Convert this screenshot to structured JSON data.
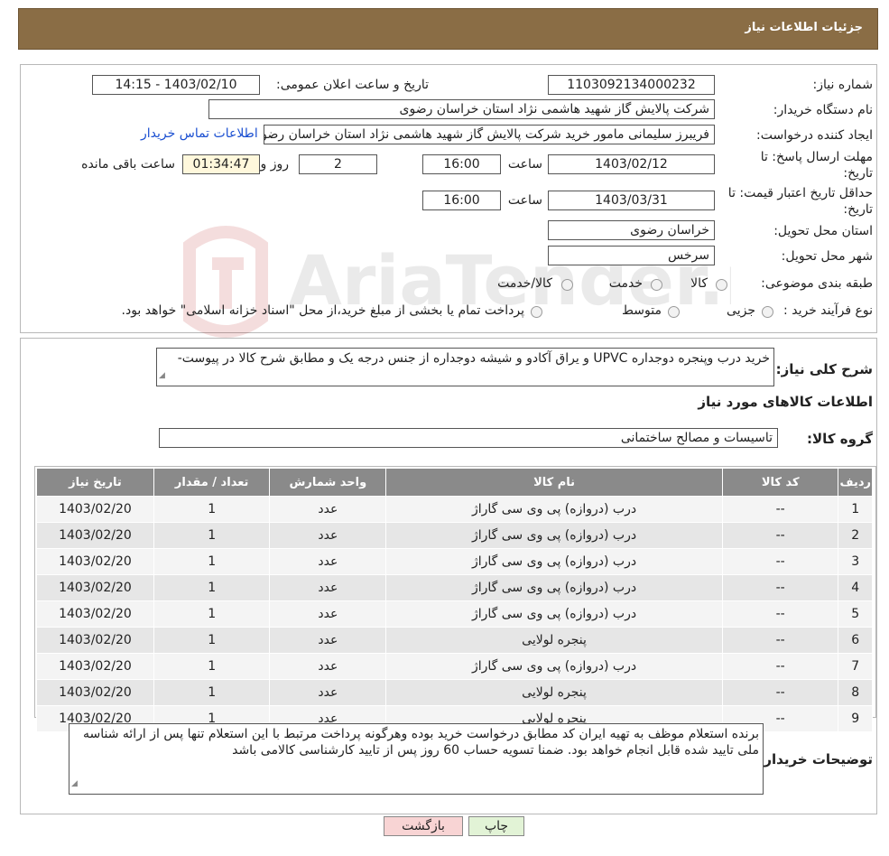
{
  "header": {
    "title": "جزئیات اطلاعات نیاز"
  },
  "form": {
    "need_number_label": "شماره نیاز:",
    "need_number": "1103092134000232",
    "announce_label": "تاریخ و ساعت اعلان عمومی:",
    "announce_value": "1403/02/10 - 14:15",
    "buyer_org_label": "نام دستگاه خریدار:",
    "buyer_org": "شرکت پالایش گاز شهید هاشمی نژاد   استان خراسان رضوی",
    "creator_label": "ایجاد کننده درخواست:",
    "creator": "فریبرز  سلیمانی مامور خرید شرکت پالایش گاز شهید هاشمی نژاد   استان خراسان رضوی",
    "contact_link": "اطلاعات تماس خریدار",
    "deadline_label_1": "مهلت ارسال پاسخ: تا",
    "deadline_label_2": "تاریخ:",
    "deadline_date": "1403/02/12",
    "time_label": "ساعت",
    "deadline_time": "16:00",
    "days_value": "2",
    "days_label": "روز و",
    "remaining_value": "01:34:47",
    "remaining_label": "ساعت باقی مانده",
    "validity_label_1": "حداقل تاریخ اعتبار قیمت: تا",
    "validity_label_2": "تاریخ:",
    "validity_date": "1403/03/31",
    "validity_time": "16:00",
    "province_label": "استان محل تحویل:",
    "province": "خراسان رضوی",
    "city_label": "شهر محل تحویل:",
    "city": "سرخس",
    "category_label": "طبقه بندی موضوعی:",
    "category_options": [
      "کالا",
      "خدمت",
      "کالا/خدمت"
    ],
    "process_label": "نوع فرآیند خرید :",
    "process_options": [
      "جزیی",
      "متوسط"
    ],
    "process_note": "پرداخت تمام یا بخشی از مبلغ خرید،از محل \"اسناد خزانه اسلامی\" خواهد بود."
  },
  "details": {
    "summary_label": "شرح کلی نیاز:",
    "summary": "خرید درب وپنجره دوجداره  UPVC  و یراق آکادو و شیشه دوجداره از جنس درجه یک و مطابق شرح کالا در پیوست-",
    "goods_info_title": "اطلاعات کالاهای مورد نیاز",
    "goods_group_label": "گروه کالا:",
    "goods_group": "تاسیسات و مصالح ساختمانی"
  },
  "table": {
    "headers": [
      "ردیف",
      "کد کالا",
      "نام کالا",
      "واحد شمارش",
      "تعداد / مقدار",
      "تاریخ نیاز"
    ],
    "rows": [
      [
        "1",
        "--",
        "درب (دروازه) پی وی سی گاراژ",
        "عدد",
        "1",
        "1403/02/20"
      ],
      [
        "2",
        "--",
        "درب (دروازه) پی وی سی گاراژ",
        "عدد",
        "1",
        "1403/02/20"
      ],
      [
        "3",
        "--",
        "درب (دروازه) پی وی سی گاراژ",
        "عدد",
        "1",
        "1403/02/20"
      ],
      [
        "4",
        "--",
        "درب (دروازه) پی وی سی گاراژ",
        "عدد",
        "1",
        "1403/02/20"
      ],
      [
        "5",
        "--",
        "درب (دروازه) پی وی سی گاراژ",
        "عدد",
        "1",
        "1403/02/20"
      ],
      [
        "6",
        "--",
        "پنجره لولایی",
        "عدد",
        "1",
        "1403/02/20"
      ],
      [
        "7",
        "--",
        "درب (دروازه) پی وی سی گاراژ",
        "عدد",
        "1",
        "1403/02/20"
      ],
      [
        "8",
        "--",
        "پنجره لولایی",
        "عدد",
        "1",
        "1403/02/20"
      ],
      [
        "9",
        "--",
        "پنجره لولایی",
        "عدد",
        "1",
        "1403/02/20"
      ]
    ]
  },
  "buyer_notes": {
    "label": "توضیحات خریدار:",
    "text": "برنده استعلام موظف به تهیه ایران کد مطابق درخواست خرید بوده وهرگونه پرداخت مرتبط با این استعلام تنها پس از ارائه شناسه ملی تایید شده قابل انجام خواهد بود. ضمنا تسویه حساب 60 روز پس از تایید کارشناسی کالامی باشد"
  },
  "buttons": {
    "print": "چاپ",
    "back": "بازگشت"
  },
  "watermark": {
    "text": "AriaTender.neT"
  },
  "colors": {
    "header": "#8a6d45",
    "table_header": "#8a8a8a",
    "back_button": "#f8d4d4",
    "print_button": "#e2f3d6",
    "link": "#1a4fd1"
  }
}
